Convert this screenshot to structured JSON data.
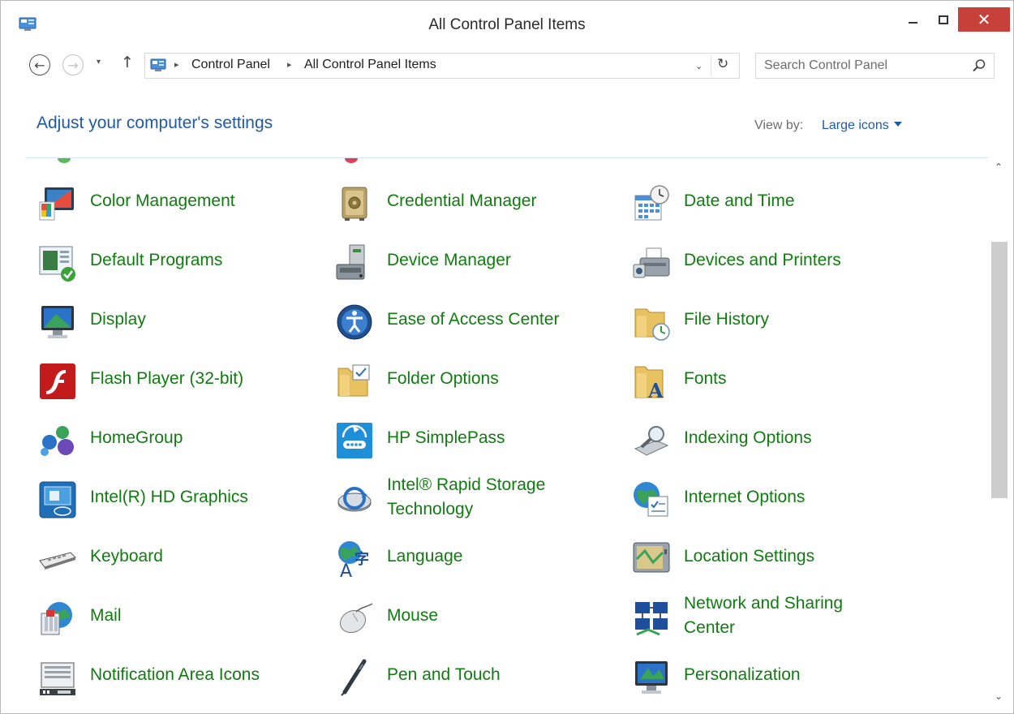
{
  "window": {
    "title": "All Control Panel Items",
    "close_glyph": "✕"
  },
  "nav": {
    "back_glyph": "←",
    "forward_glyph": "→",
    "recent_glyph": "▾",
    "up_glyph": "↑",
    "refresh_glyph": "↻",
    "dropdown_glyph": "⌄",
    "breadcrumb": [
      "Control Panel",
      "All Control Panel Items"
    ],
    "separator": "▸"
  },
  "search": {
    "placeholder": "Search Control Panel",
    "value": ""
  },
  "header": {
    "title": "Adjust your computer's settings",
    "view_by_label": "View by:",
    "view_by_value": "Large icons"
  },
  "scroll": {
    "up_glyph": "⌃",
    "down_glyph": "⌄"
  },
  "items": [
    [
      "Color Management",
      "Credential Manager",
      "Date and Time"
    ],
    [
      "Default Programs",
      "Device Manager",
      "Devices and Printers"
    ],
    [
      "Display",
      "Ease of Access Center",
      "File History"
    ],
    [
      "Flash Player (32-bit)",
      "Folder Options",
      "Fonts"
    ],
    [
      "HomeGroup",
      "HP SimplePass",
      "Indexing Options"
    ],
    [
      "Intel(R) HD Graphics",
      "Intel® Rapid Storage Technology",
      "Internet Options"
    ],
    [
      "Keyboard",
      "Language",
      "Location Settings"
    ],
    [
      "Mail",
      "Mouse",
      "Network and Sharing Center"
    ],
    [
      "Notification Area Icons",
      "Pen and Touch",
      "Personalization"
    ]
  ],
  "colors": {
    "link_green": "#107c10",
    "header_blue": "#1e5aa8",
    "close_red": "#c7403a"
  }
}
